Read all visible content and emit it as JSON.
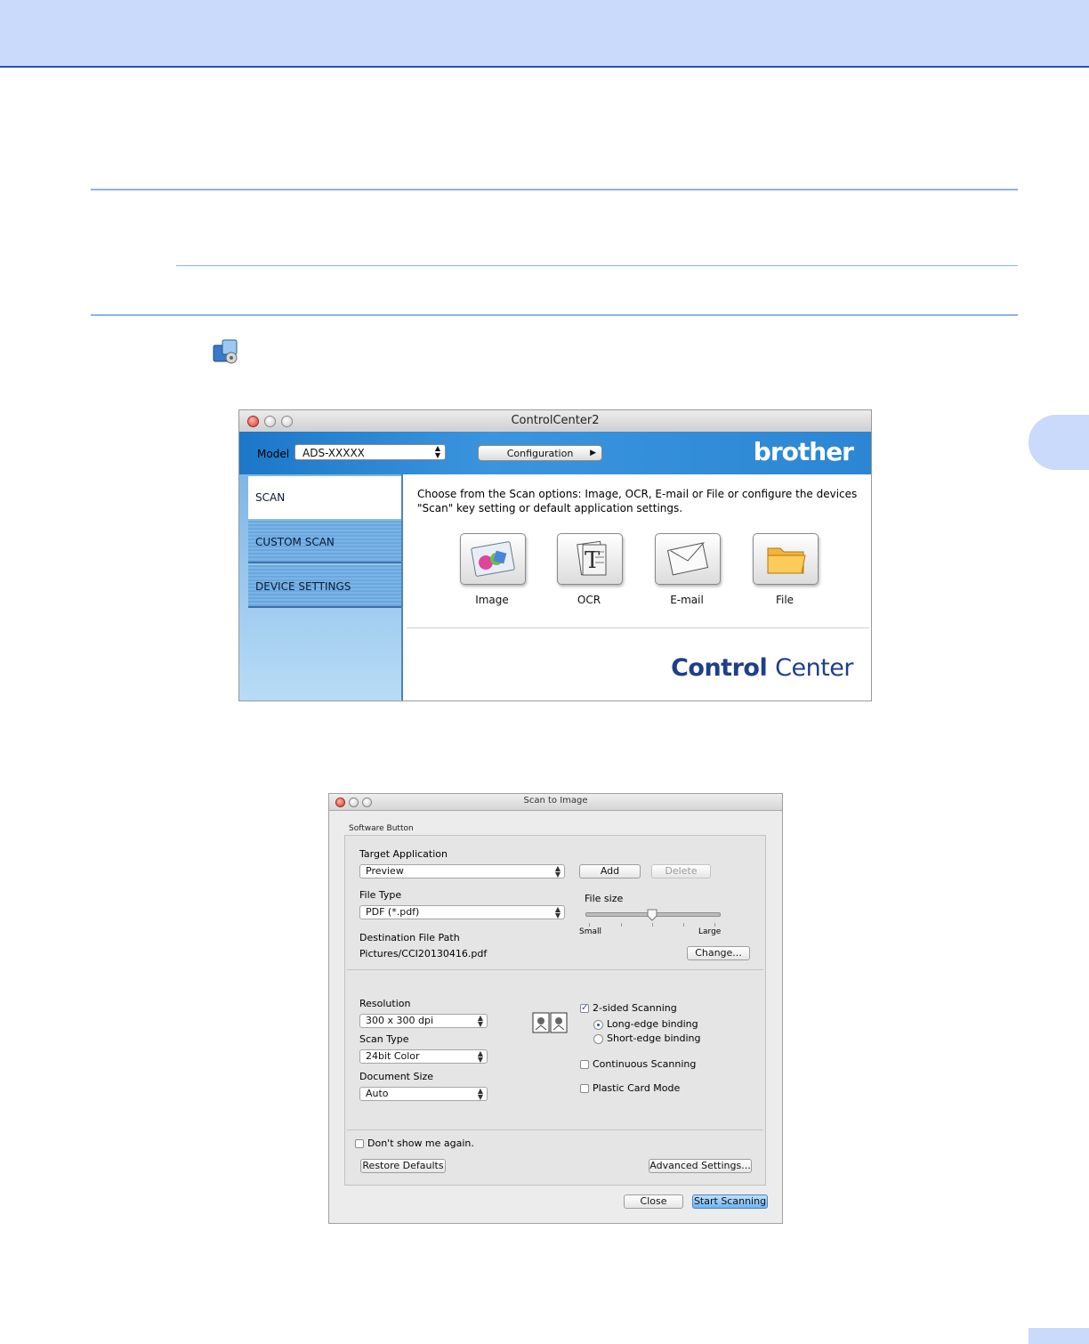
{
  "controlcenter": {
    "title": "ControlCenter2",
    "model_label": "Model",
    "model_value": "ADS-XXXXX",
    "configuration_label": "Configuration",
    "brand_logo": "brother",
    "tabs": [
      {
        "label": "SCAN"
      },
      {
        "label": "CUSTOM SCAN"
      },
      {
        "label": "DEVICE SETTINGS"
      }
    ],
    "description_line1": "Choose from the Scan options: Image, OCR, E-mail or File or configure the devices",
    "description_line2": "\"Scan\" key setting or default application settings.",
    "functions": [
      {
        "label": "Image",
        "icon": "image-icon"
      },
      {
        "label": "OCR",
        "icon": "ocr-icon"
      },
      {
        "label": "E-mail",
        "icon": "email-icon"
      },
      {
        "label": "File",
        "icon": "folder-icon"
      }
    ],
    "footer_logo_bold": "Control",
    "footer_logo_regular": "Center"
  },
  "dialog": {
    "title": "Scan to Image",
    "group_label": "Software Button",
    "target_application_label": "Target Application",
    "target_application_value": "Preview",
    "add_label": "Add",
    "delete_label": "Delete",
    "file_type_label": "File Type",
    "file_type_value": "PDF (*.pdf)",
    "file_size_label": "File size",
    "file_size_small": "Small",
    "file_size_large": "Large",
    "file_size_level": 0.5,
    "destination_label": "Destination File Path",
    "destination_value": "Pictures/CCI20130416.pdf",
    "change_label": "Change...",
    "resolution_label": "Resolution",
    "resolution_value": "300 x 300 dpi",
    "scan_type_label": "Scan Type",
    "scan_type_value": "24bit Color",
    "document_size_label": "Document Size",
    "document_size_value": "Auto",
    "two_sided_label": "2-sided Scanning",
    "two_sided_checked": true,
    "long_edge_label": "Long-edge binding",
    "short_edge_label": "Short-edge binding",
    "continuous_label": "Continuous Scanning",
    "plastic_card_label": "Plastic Card Mode",
    "dont_show_label": "Don't show me again.",
    "restore_defaults_label": "Restore Defaults",
    "advanced_settings_label": "Advanced Settings...",
    "close_label": "Close",
    "start_scanning_label": "Start Scanning"
  },
  "colors": {
    "banner": "#c9dafb",
    "accent_rule": "#8fb1e8",
    "cc_blue": "#2b86d4"
  }
}
